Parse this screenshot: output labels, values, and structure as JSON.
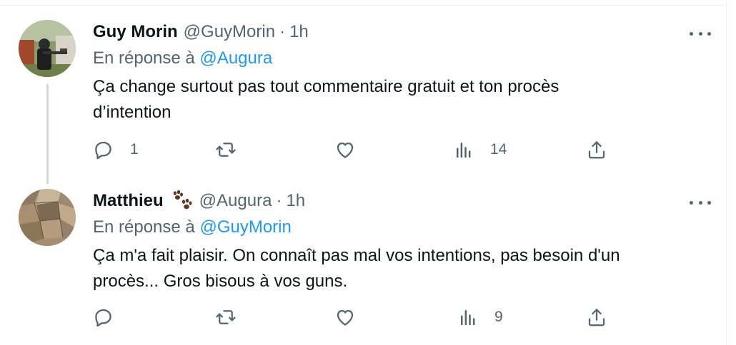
{
  "tweets": [
    {
      "author_name": "Guy Morin",
      "handle": "@GuyMorin",
      "separator": "·",
      "time": "1h",
      "reply_prefix": "En réponse à",
      "reply_mention": "@Augura",
      "text_line1": "Ça change surtout pas tout commentaire gratuit et ton procès",
      "text_line2": "d’intention",
      "reply_count": "1",
      "retweet_count": "",
      "like_count": "",
      "views_count": "14",
      "icons": [
        "reply-icon",
        "retweet-icon",
        "like-icon",
        "views-icon",
        "share-icon",
        "more-icon"
      ]
    },
    {
      "author_name": "Matthieu",
      "handle": "@Augura",
      "separator": "·",
      "time": "1h",
      "reply_prefix": "En réponse à",
      "reply_mention": "@GuyMorin",
      "text_line1": "Ça m'a fait plaisir. On connaît pas mal vos intentions, pas besoin d'un",
      "text_line2": "procès... Gros bisous à vos guns.",
      "reply_count": "",
      "retweet_count": "",
      "like_count": "",
      "views_count": "9",
      "badge_icon": "paw-prints-icon",
      "icons": [
        "reply-icon",
        "retweet-icon",
        "like-icon",
        "views-icon",
        "share-icon",
        "more-icon"
      ]
    }
  ],
  "colors": {
    "text": "#0f1419",
    "secondary": "#536471",
    "link": "#1d9bf0",
    "thread_line": "#cfd9de"
  }
}
